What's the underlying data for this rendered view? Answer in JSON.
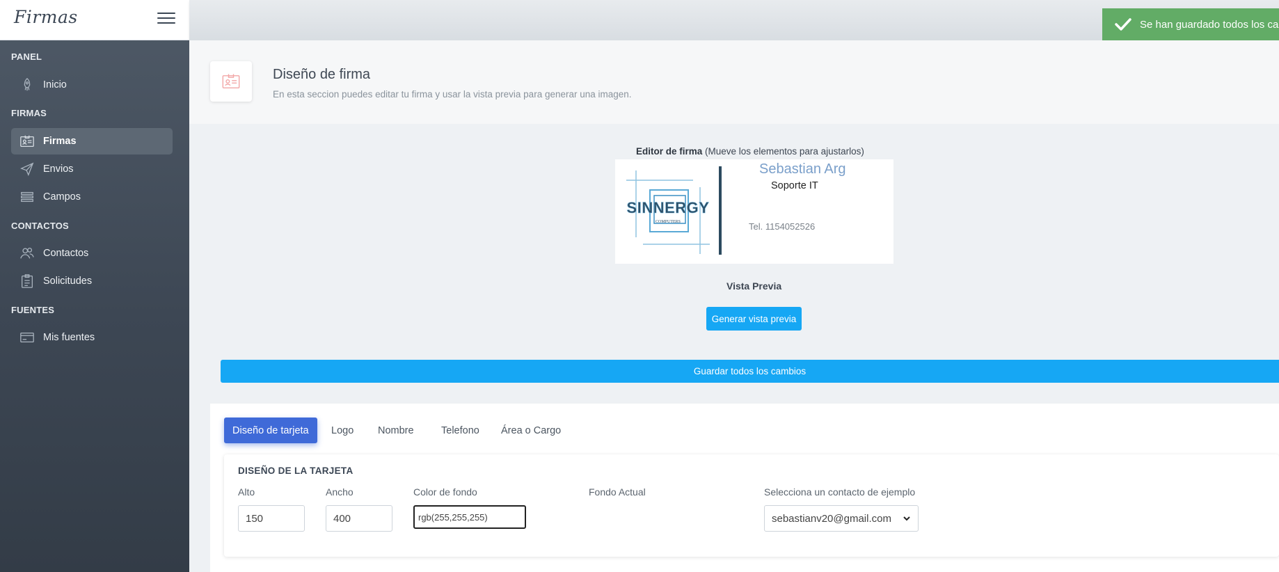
{
  "brand": {
    "name": "Firmas"
  },
  "sidebar": {
    "sections": [
      {
        "heading": "PANEL",
        "items": [
          {
            "label": "Inicio",
            "icon": "rocket-icon"
          }
        ]
      },
      {
        "heading": "FIRMAS",
        "items": [
          {
            "label": "Firmas",
            "icon": "id-card-icon",
            "active": true
          },
          {
            "label": "Envios",
            "icon": "paper-plane-icon"
          },
          {
            "label": "Campos",
            "icon": "rows-icon"
          }
        ]
      },
      {
        "heading": "CONTACTOS",
        "items": [
          {
            "label": "Contactos",
            "icon": "users-icon"
          },
          {
            "label": "Solicitudes",
            "icon": "clipboard-icon"
          }
        ]
      },
      {
        "heading": "FUENTES",
        "items": [
          {
            "label": "Mis fuentes",
            "icon": "credit-card-icon"
          }
        ]
      }
    ]
  },
  "toast": {
    "message": "Se han guardado todos los cambios",
    "color": "#62ac66"
  },
  "header": {
    "title": "Diseño de firma",
    "subtitle": "En esta seccion puedes editar tu firma y usar la vista previa para generar una imagen."
  },
  "editor": {
    "label_bold": "Editor de firma",
    "label_hint": "(Mueve los elementos para ajustarlos)",
    "card": {
      "logo_text": "SINNERGY",
      "logo_subtext": "COMPUTERS",
      "name": "Sebastian Arg",
      "role": "Soporte IT",
      "phone": "Tel. 1154052526"
    }
  },
  "preview": {
    "label": "Vista Previa",
    "button": "Generar vista previa"
  },
  "save_all": {
    "button": "Guardar todos los cambios",
    "color": "#16a7f4"
  },
  "tabs": [
    {
      "label": "Diseño de tarjeta",
      "active": true
    },
    {
      "label": "Logo"
    },
    {
      "label": "Nombre"
    },
    {
      "label": "Telefono"
    },
    {
      "label": "Área o Cargo"
    }
  ],
  "card_design": {
    "title": "DISEÑO DE LA TARJETA",
    "fields": {
      "alto": {
        "label": "Alto",
        "value": "150"
      },
      "ancho": {
        "label": "Ancho",
        "value": "400"
      },
      "color_fondo": {
        "label": "Color de fondo",
        "value": "rgb(255,255,255)"
      },
      "fondo_actual": {
        "label": "Fondo Actual"
      },
      "contacto": {
        "label": "Selecciona un contacto de ejemplo",
        "value": "sebastianv20@gmail.com"
      }
    }
  },
  "colors": {
    "accent": "#3f6ad8",
    "sidebar_bg": "#3d4754"
  }
}
